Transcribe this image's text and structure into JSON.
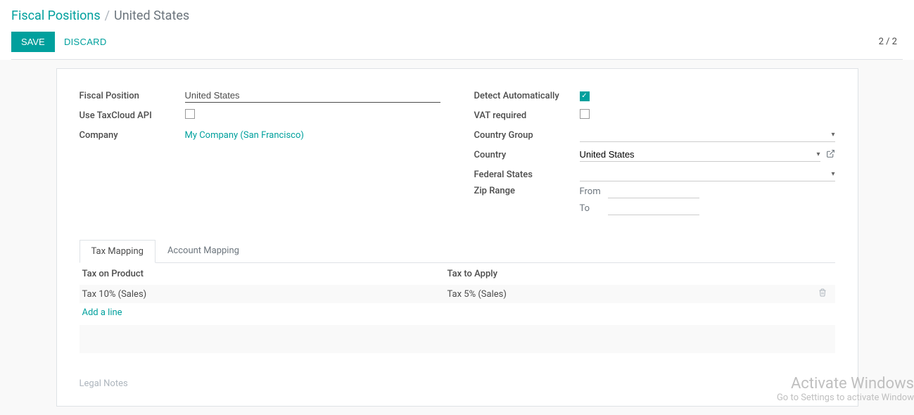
{
  "breadcrumb": {
    "root": "Fiscal Positions",
    "sep": "/",
    "current": "United States"
  },
  "actions": {
    "save": "SAVE",
    "discard": "DISCARD"
  },
  "pager": "2 / 2",
  "fields": {
    "fiscal_position": {
      "label": "Fiscal Position",
      "value": "United States"
    },
    "use_taxcloud": {
      "label": "Use TaxCloud API",
      "checked": false
    },
    "company": {
      "label": "Company",
      "value": "My Company (San Francisco)"
    },
    "detect_auto": {
      "label": "Detect Automatically",
      "checked": true
    },
    "vat_required": {
      "label": "VAT required",
      "checked": false
    },
    "country_group": {
      "label": "Country Group",
      "value": ""
    },
    "country": {
      "label": "Country",
      "value": "United States"
    },
    "federal_states": {
      "label": "Federal States",
      "value": ""
    },
    "zip_range": {
      "label": "Zip Range",
      "from_label": "From",
      "to_label": "To",
      "from": "",
      "to": ""
    }
  },
  "tabs": {
    "tax": "Tax Mapping",
    "account": "Account Mapping"
  },
  "tax_table": {
    "col1": "Tax on Product",
    "col2": "Tax to Apply",
    "rows": [
      {
        "product": "Tax 10% (Sales)",
        "apply": "Tax 5% (Sales)"
      }
    ],
    "add": "Add a line"
  },
  "legal_notes": "Legal Notes",
  "watermark": {
    "line1": "Activate Windows",
    "line2": "Go to Settings to activate Window"
  }
}
